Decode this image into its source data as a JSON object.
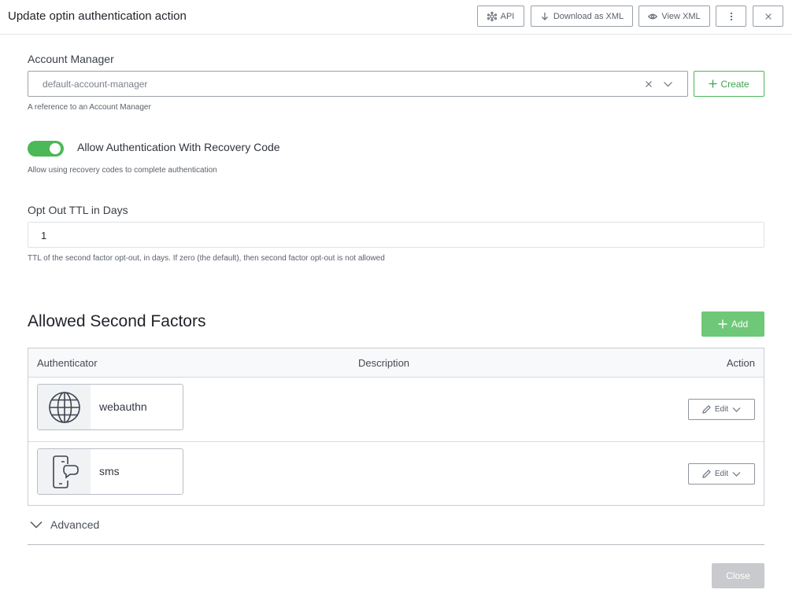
{
  "header": {
    "title": "Update optin authentication action",
    "api_label": "API",
    "download_label": "Download as XML",
    "view_label": "View XML"
  },
  "account_manager": {
    "label": "Account Manager",
    "value": "default-account-manager",
    "help": "A reference to an Account Manager",
    "create_label": "Create"
  },
  "recovery": {
    "label": "Allow Authentication With Recovery Code",
    "help": "Allow using recovery codes to complete authentication",
    "enabled": true
  },
  "opt_out": {
    "label": "Opt Out TTL in Days",
    "value": "1",
    "help": "TTL of the second factor opt-out, in days. If zero (the default), then second factor opt-out is not allowed"
  },
  "factors": {
    "title": "Allowed Second Factors",
    "add_label": "Add",
    "columns": [
      "Authenticator",
      "Description",
      "Action"
    ],
    "rows": [
      {
        "name": "webauthn",
        "icon": "globe-icon",
        "edit_label": "Edit"
      },
      {
        "name": "sms",
        "icon": "phone-chat-icon",
        "edit_label": "Edit"
      }
    ]
  },
  "advanced_label": "Advanced",
  "close_label": "Close",
  "colors": {
    "accent_green": "#4cb857",
    "add_button_green": "#6ec877",
    "disabled_grey": "#c8cacd"
  }
}
